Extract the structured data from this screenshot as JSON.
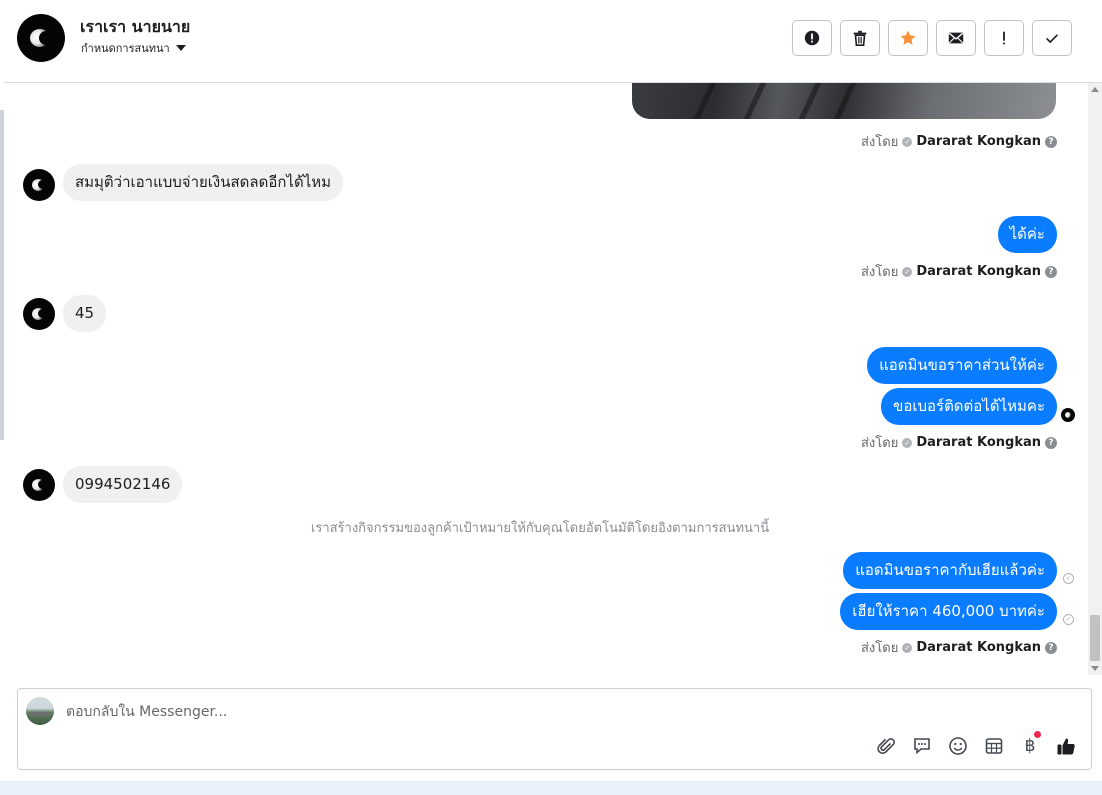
{
  "header": {
    "contact_name": "เราเรา นายนาย",
    "status_label": "กำหนดการสนทนา",
    "toolbar": [
      {
        "icon": "alert-circle-icon",
        "title": "spam"
      },
      {
        "icon": "trash-icon",
        "title": "delete"
      },
      {
        "icon": "star-icon",
        "title": "star"
      },
      {
        "icon": "envelope-icon",
        "title": "mark-unread"
      },
      {
        "icon": "exclamation-icon",
        "title": "follow-up"
      },
      {
        "icon": "checkmark-icon",
        "title": "done"
      }
    ],
    "star_color": "#f7923a"
  },
  "conversation": {
    "sent_by_label": "ส่งโดย",
    "agent_name": "Dararat Kongkan",
    "help_glyph": "?",
    "messages": {
      "in_1": "สมมุติว่าเอาแบบจ่ายเงินสดลดอีกได้ไหม",
      "out_1": "ได้ค่ะ",
      "in_2": "45",
      "out_2a": "แอดมินขอราคาส่วนให้ค่ะ",
      "out_2b": "ขอเบอร์ติดต่อได้ไหมคะ",
      "in_3": "0994502146",
      "out_3a": "แอดมินขอราคากับเฮียแล้วค่ะ",
      "out_3b": "เฮียให้ราคา 460,000 บาทค่ะ"
    },
    "system_note": "เราสร้างกิจกรรมของลูกค้าเป้าหมายให้กับคุณโดยอัตโนมัติโดยอิงตามการสนทนานี้",
    "outgoing_color": "#0a7cff",
    "incoming_color": "#f0f0f0"
  },
  "composer": {
    "placeholder": "ตอบกลับใน Messenger...",
    "tools": [
      "paperclip-icon",
      "saved-replies-icon",
      "emoji-icon",
      "appointment-icon",
      "payment-baht-icon",
      "like-icon"
    ],
    "baht_glyph": "฿"
  }
}
